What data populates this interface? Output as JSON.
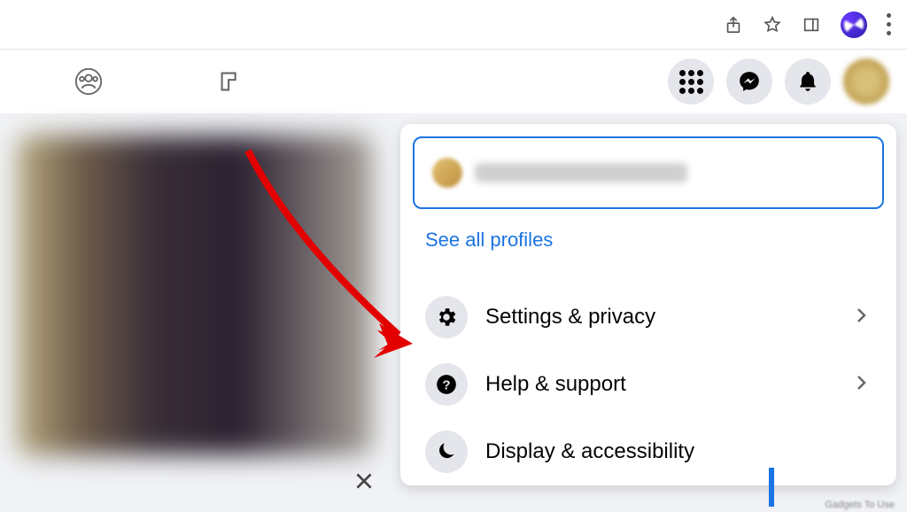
{
  "dropdown": {
    "see_all_label": "See all profiles",
    "items": [
      {
        "label": "Settings & privacy"
      },
      {
        "label": "Help & support"
      },
      {
        "label": "Display & accessibility"
      }
    ]
  }
}
